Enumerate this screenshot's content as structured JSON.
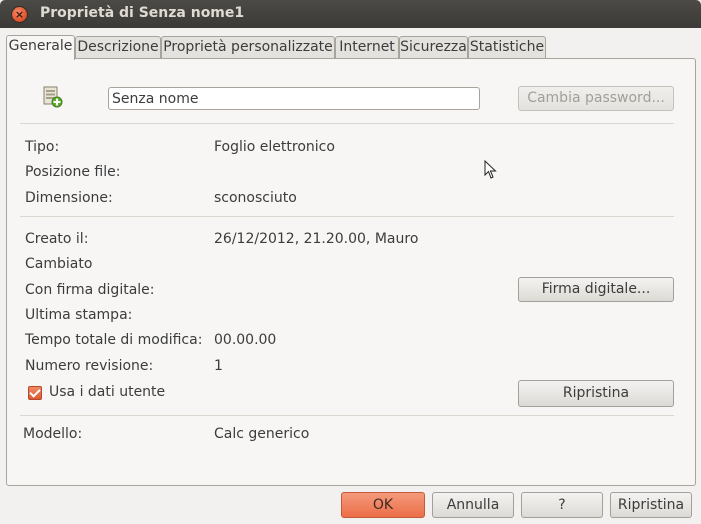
{
  "window": {
    "title": "Proprietà di Senza nome1",
    "close_icon": "×"
  },
  "tabs": [
    {
      "label": "Generale"
    },
    {
      "label": "Descrizione"
    },
    {
      "label": "Proprietà personalizzate"
    },
    {
      "label": "Internet"
    },
    {
      "label": "Sicurezza"
    },
    {
      "label": "Statistiche"
    }
  ],
  "general": {
    "name_value": "Senza nome",
    "change_password_label": "Cambia password...",
    "type_label": "Tipo:",
    "type_value": "Foglio elettronico",
    "location_label": "Posizione file:",
    "location_value": "",
    "size_label": "Dimensione:",
    "size_value": "sconosciuto",
    "created_label": "Creato il:",
    "created_value": "26/12/2012, 21.20.00, Mauro",
    "modified_label": "Cambiato",
    "signed_label": "Con firma digitale:",
    "digital_signature_label": "Firma digitale...",
    "printed_label": "Ultima stampa:",
    "edit_time_label": "Tempo totale di modifica:",
    "edit_time_value": "00.00.00",
    "revision_label": "Numero revisione:",
    "revision_value": "1",
    "use_user_data_label": "Usa i dati utente",
    "use_user_data_checked": true,
    "reset_label": "Ripristina",
    "template_label": "Modello:",
    "template_value": "Calc generico"
  },
  "footer": {
    "ok_label": "OK",
    "cancel_label": "Annulla",
    "help_label": "?",
    "reset_label": "Ripristina"
  }
}
